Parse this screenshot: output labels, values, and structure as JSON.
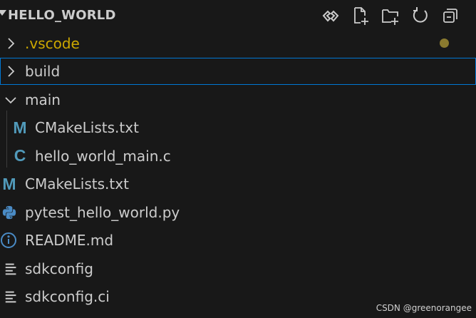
{
  "explorer": {
    "title": "HELLO_WORLD",
    "actions": [
      {
        "name": "refresh-source-icon"
      },
      {
        "name": "new-file-icon"
      },
      {
        "name": "new-folder-icon"
      },
      {
        "name": "refresh-icon"
      },
      {
        "name": "collapse-all-icon"
      }
    ]
  },
  "tree": {
    "items": [
      {
        "label": ".vscode",
        "kind": "folder",
        "expanded": false,
        "color": "#cca700",
        "modified": true
      },
      {
        "label": "build",
        "kind": "folder",
        "expanded": false,
        "color": "#cccccc",
        "focused": true
      },
      {
        "label": "main",
        "kind": "folder",
        "expanded": true,
        "color": "#cccccc"
      },
      {
        "label": "CMakeLists.txt",
        "kind": "cmake",
        "icon": "M",
        "color": "#cccccc"
      },
      {
        "label": "hello_world_main.c",
        "kind": "c",
        "icon": "C",
        "color": "#cccccc"
      },
      {
        "label": "CMakeLists.txt",
        "kind": "cmake",
        "icon": "M",
        "color": "#cccccc"
      },
      {
        "label": "pytest_hello_world.py",
        "kind": "python",
        "color": "#cccccc"
      },
      {
        "label": "README.md",
        "kind": "info",
        "color": "#cccccc"
      },
      {
        "label": "sdkconfig",
        "kind": "text",
        "color": "#cccccc"
      },
      {
        "label": "sdkconfig.ci",
        "kind": "text",
        "color": "#cccccc"
      }
    ]
  },
  "colors": {
    "background": "#181818",
    "accent_focus": "#0078d4",
    "modified_dot": "#8a7a2f",
    "icon_blue": "#519aba",
    "python_blue": "#4a8bc5"
  },
  "watermark": "CSDN @greenorangee"
}
